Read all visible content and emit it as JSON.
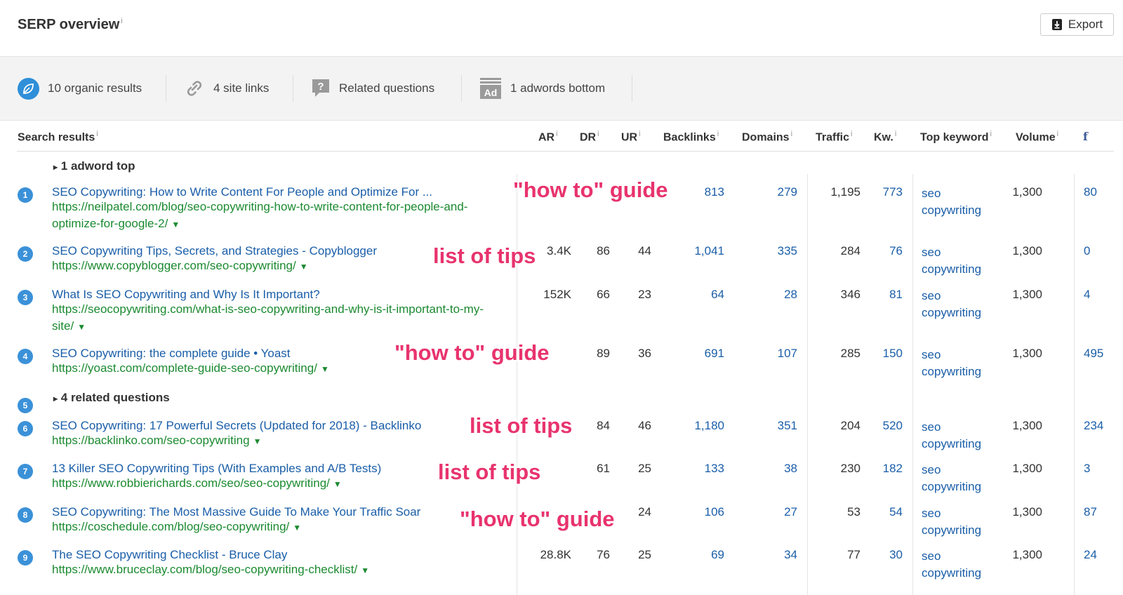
{
  "header": {
    "title": "SERP overview",
    "info": "i",
    "export_label": "Export"
  },
  "features": {
    "organic": "10 organic results",
    "sitelinks": "4 site links",
    "questions": "Related questions",
    "adwords": "1 adwords bottom",
    "ad_icon_text": "Ad"
  },
  "columns": {
    "results": "Search results",
    "ar": "AR",
    "dr": "DR",
    "ur": "UR",
    "backlinks": "Backlinks",
    "domains": "Domains",
    "traffic": "Traffic",
    "kw": "Kw.",
    "top_keyword": "Top keyword",
    "volume": "Volume",
    "fb": "f",
    "info": "i"
  },
  "groups": {
    "adword_top": "1 adword top",
    "related_questions": "4 related questions",
    "toggle": "▸"
  },
  "rows": [
    {
      "n": "1",
      "title": "SEO Copywriting: How to Write Content For People and Optimize For ...",
      "url": "https://neilpatel.com/blog/seo-copywriting-how-to-write-content-for-people-and-optimize-for-google-2/",
      "ar": "",
      "dr": "",
      "ur": "",
      "backlinks": "813",
      "domains": "279",
      "traffic": "1,195",
      "kw": "773",
      "top_keyword": "seo copywriting",
      "volume": "1,300",
      "fb": "80"
    },
    {
      "n": "2",
      "title": "SEO Copywriting Tips, Secrets, and Strategies - Copyblogger",
      "url": "https://www.copyblogger.com/seo-copywriting/",
      "ar": "3.4K",
      "dr": "86",
      "ur": "44",
      "backlinks": "1,041",
      "domains": "335",
      "traffic": "284",
      "kw": "76",
      "top_keyword": "seo copywriting",
      "volume": "1,300",
      "fb": "0"
    },
    {
      "n": "3",
      "title": "What Is SEO Copywriting and Why Is It Important?",
      "url": "https://seocopywriting.com/what-is-seo-copywriting-and-why-is-it-important-to-my-site/",
      "ar": "152K",
      "dr": "66",
      "ur": "23",
      "backlinks": "64",
      "domains": "28",
      "traffic": "346",
      "kw": "81",
      "top_keyword": "seo copywriting",
      "volume": "1,300",
      "fb": "4"
    },
    {
      "n": "4",
      "title": "SEO Copywriting: the complete guide • Yoast",
      "url": "https://yoast.com/complete-guide-seo-copywriting/",
      "ar": "",
      "dr": "89",
      "ur": "36",
      "backlinks": "691",
      "domains": "107",
      "traffic": "285",
      "kw": "150",
      "top_keyword": "seo copywriting",
      "volume": "1,300",
      "fb": "495"
    },
    {
      "n": "6",
      "title": "SEO Copywriting: 17 Powerful Secrets (Updated for 2018) - Backlinko",
      "url": "https://backlinko.com/seo-copywriting",
      "ar": "",
      "dr": "84",
      "ur": "46",
      "backlinks": "1,180",
      "domains": "351",
      "traffic": "204",
      "kw": "520",
      "top_keyword": "seo copywriting",
      "volume": "1,300",
      "fb": "234"
    },
    {
      "n": "7",
      "title": "13 Killer SEO Copywriting Tips (With Examples and A/B Tests)",
      "url": "https://www.robbierichards.com/seo/seo-copywriting/",
      "ar": "",
      "dr": "61",
      "ur": "25",
      "backlinks": "133",
      "domains": "38",
      "traffic": "230",
      "kw": "182",
      "top_keyword": "seo copywriting",
      "volume": "1,300",
      "fb": "3"
    },
    {
      "n": "8",
      "title": "SEO Copywriting: The Most Massive Guide To Make Your Traffic Soar",
      "url": "https://coschedule.com/blog/seo-copywriting/",
      "ar": "",
      "dr": "",
      "ur": "24",
      "backlinks": "106",
      "domains": "27",
      "traffic": "53",
      "kw": "54",
      "top_keyword": "seo copywriting",
      "volume": "1,300",
      "fb": "87"
    },
    {
      "n": "9",
      "title": "The SEO Copywriting Checklist - Bruce Clay",
      "url": "https://www.bruceclay.com/blog/seo-copywriting-checklist/",
      "ar": "28.8K",
      "dr": "76",
      "ur": "25",
      "backlinks": "69",
      "domains": "34",
      "traffic": "77",
      "kw": "30",
      "top_keyword": "seo copywriting",
      "volume": "1,300",
      "fb": "24"
    }
  ],
  "related_number": "5",
  "annotations": {
    "a1": "\"how to\" guide",
    "a2": "list of tips",
    "a3": "\"how to\" guide",
    "a4": "list of tips",
    "a5": "list of tips",
    "a6": "\"how to\" guide"
  },
  "colors": {
    "link": "#1a5ea8",
    "url": "#1b8a30",
    "badge": "#3b91d8",
    "annotation": "#e8336e"
  }
}
